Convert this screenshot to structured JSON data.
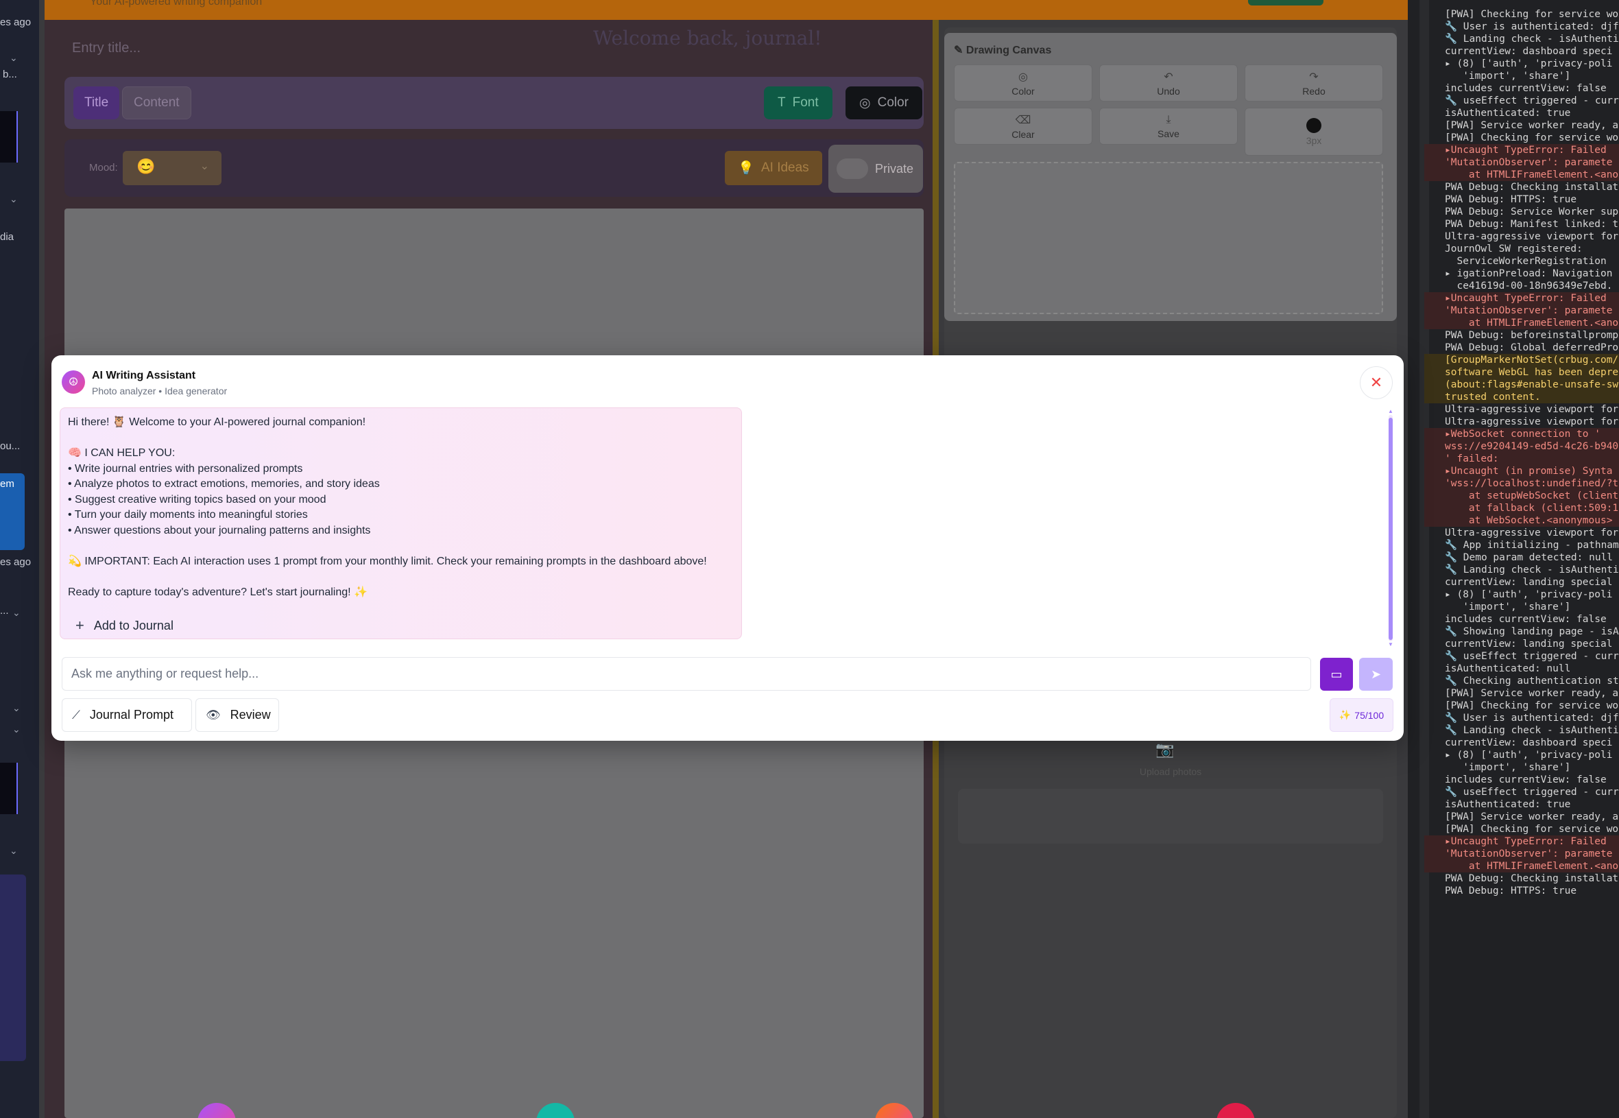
{
  "left_sidebar": {
    "fragments": [
      "es ago",
      "b...",
      "dia",
      "ou...",
      "em",
      "es ago",
      "..."
    ]
  },
  "app": {
    "header": {
      "subtitle": "Your AI-powered writing companion"
    },
    "editor": {
      "title_placeholder": "Entry title...",
      "background_text": "Welcome back, journal!",
      "format_buttons": {
        "title": "Title",
        "content": "Content",
        "font": "Font",
        "color": "Color"
      },
      "mood_label": "Mood:",
      "mood_value": "😊",
      "ai_ideas": "AI Ideas",
      "private": "Private"
    },
    "drawing_canvas": {
      "title": "Drawing Canvas",
      "tools": [
        {
          "icon": "palette-icon",
          "label": "Color"
        },
        {
          "icon": "undo-icon",
          "label": "Undo"
        },
        {
          "icon": "redo-icon",
          "label": "Redo"
        },
        {
          "icon": "eraser-icon",
          "label": "Clear"
        },
        {
          "icon": "download-icon",
          "label": "Save"
        },
        {
          "icon": "brush-size-dot",
          "label": "3px"
        }
      ]
    },
    "photos": {
      "upload_label": "Upload photos"
    }
  },
  "modal": {
    "title": "AI Writing Assistant",
    "subtitle": "Photo analyzer • Idea generator",
    "message": {
      "greeting": "Hi there! 🦉 Welcome to your AI-powered journal companion!",
      "help_header": "🧠 I CAN HELP YOU:",
      "bullets": [
        "• Write journal entries with personalized prompts",
        "• Analyze photos to extract emotions, memories, and story ideas",
        "• Suggest creative writing topics based on your mood",
        "• Turn your daily moments into meaningful stories",
        "• Answer questions about your journaling patterns and insights"
      ],
      "important": "💫 IMPORTANT: Each AI interaction uses 1 prompt from your monthly limit. Check your remaining prompts in the dashboard above!",
      "closing": "Ready to capture today's adventure? Let's start journaling! ✨"
    },
    "add_to_journal": "Add to Journal",
    "input_placeholder": "Ask me anything or request help...",
    "actions": {
      "journal_prompt": "Journal Prompt",
      "review": "Review"
    },
    "usage": {
      "icon": "✨",
      "text": "75/100"
    }
  },
  "console": {
    "lines": [
      "[PWA] Checking for service wo",
      "🔧 User is authenticated: djf",
      "🔧 Landing check - isAuthenti",
      "currentView: dashboard speci",
      "▸ (8) ['auth', 'privacy-poli",
      "   'import', 'share']",
      "includes currentView: false",
      "🔧 useEffect triggered - curr",
      "isAuthenticated: true",
      "[PWA] Service worker ready, a",
      "[PWA] Checking for service wo",
      "▸Uncaught TypeError: Failed",
      "'MutationObserver': paramete",
      "    at HTMLIFrameElement.<ano",
      "PWA Debug: Checking installat",
      "PWA Debug: HTTPS: true",
      "PWA Debug: Service Worker sup",
      "PWA Debug: Manifest linked: t",
      "Ultra-aggressive viewport for",
      "JournOwl SW registered:",
      "  ServiceWorkerRegistration",
      "▸ igationPreload: Navigation",
      "  ce41619d-00-18n96349e7ebd.",
      "▸Uncaught TypeError: Failed",
      "'MutationObserver': paramete",
      "    at HTMLIFrameElement.<ano",
      "PWA Debug: beforeinstallpromp",
      "PWA Debug: Global deferredPro",
      "[GroupMarkerNotSet(crbug.com/",
      "software WebGL has been depre",
      "(about:flags#enable-unsafe-sw",
      "trusted content.",
      "Ultra-aggressive viewport for",
      "Ultra-aggressive viewport for",
      "▸WebSocket connection to '",
      "wss://e9204149-ed5d-4c26-b940",
      "' failed:",
      "▸Uncaught (in promise) Synta",
      "'wss://localhost:undefined/?t",
      "    at setupWebSocket (client",
      "    at fallback (client:509:1",
      "    at WebSocket.<anonymous>",
      "Ultra-aggressive viewport for",
      "🔧 App initializing - pathnam",
      "🔧 Demo param detected: null",
      "🔧 Landing check - isAuthenti",
      "currentView: landing special",
      "▸ (8) ['auth', 'privacy-poli",
      "   'import', 'share']",
      "includes currentView: false",
      "🔧 Showing landing page - isA",
      "currentView: landing special",
      "🔧 useEffect triggered - curr",
      "isAuthenticated: null",
      "🔧 Checking authentication st",
      "[PWA] Service worker ready, a",
      "[PWA] Checking for service wo",
      "🔧 User is authenticated: djf",
      "🔧 Landing check - isAuthenti",
      "currentView: dashboard speci",
      "▸ (8) ['auth', 'privacy-poli",
      "   'import', 'share']",
      "includes currentView: false",
      "🔧 useEffect triggered - curr",
      "isAuthenticated: true",
      "[PWA] Service worker ready, a",
      "[PWA] Checking for service wo",
      "▸Uncaught TypeError: Failed",
      "'MutationObserver': paramete",
      "    at HTMLIFrameElement.<ano",
      "PWA Debug: Checking installat",
      "PWA Debug: HTTPS: true"
    ]
  }
}
